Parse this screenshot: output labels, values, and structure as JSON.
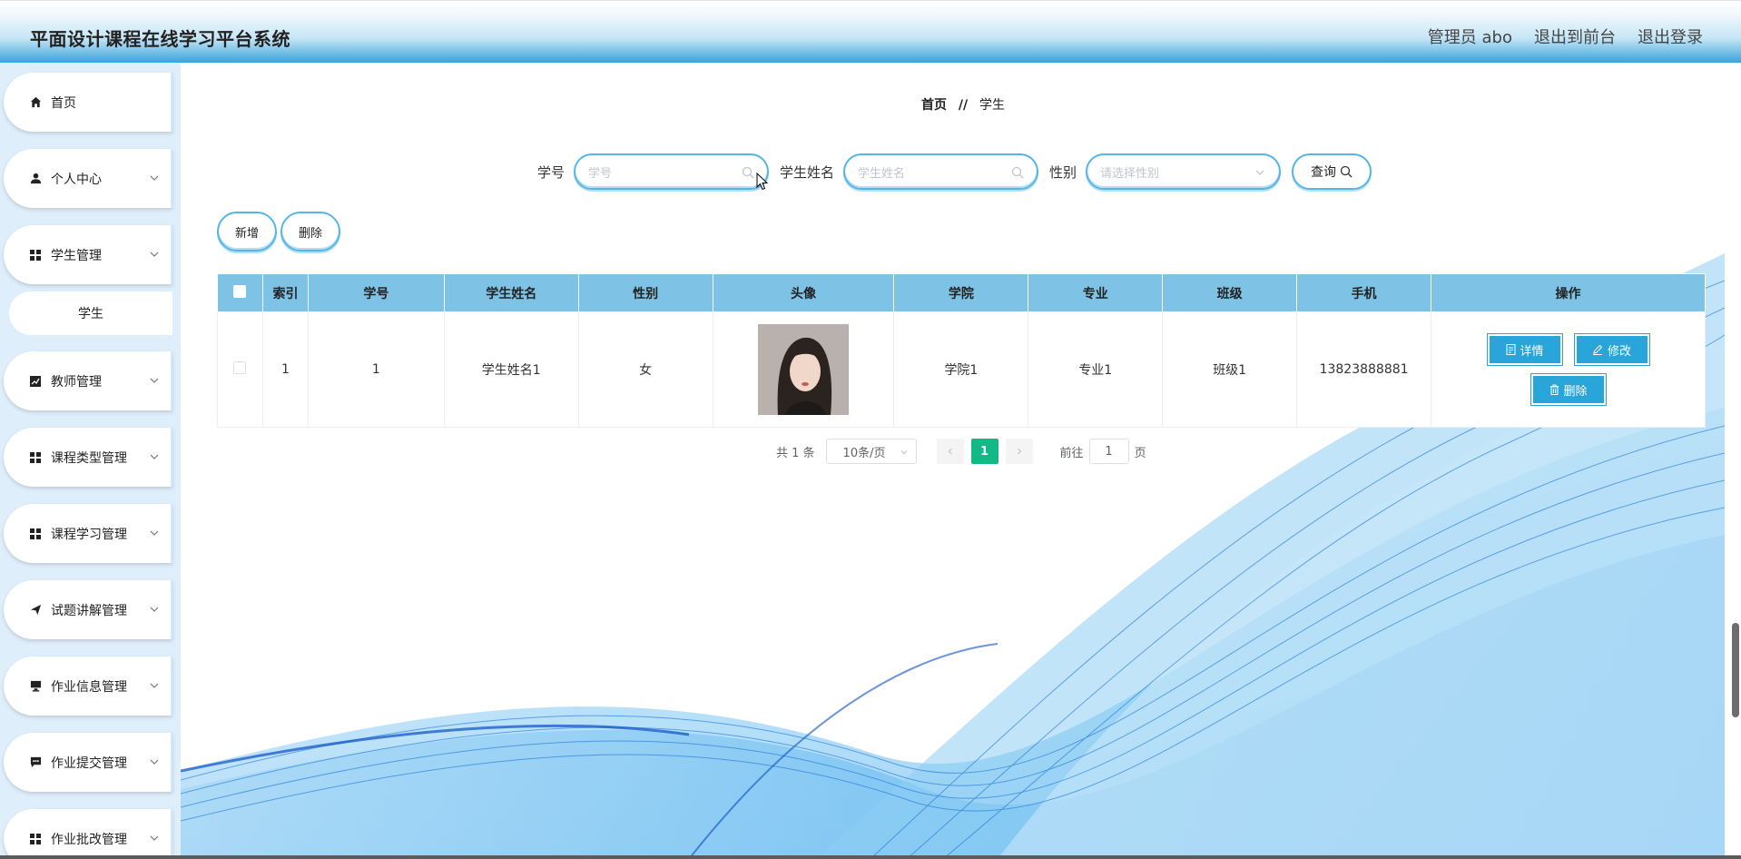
{
  "header": {
    "title": "平面设计课程在线学习平台系统",
    "admin": "管理员 abo",
    "to_front": "退出到前台",
    "logout": "退出登录"
  },
  "sidebar": {
    "items": [
      {
        "label": "首页",
        "icon": "home-icon"
      },
      {
        "label": "个人中心",
        "icon": "user-icon"
      },
      {
        "label": "学生管理",
        "icon": "grid-icon"
      },
      {
        "label": "教师管理",
        "icon": "chart-icon"
      },
      {
        "label": "课程类型管理",
        "icon": "grid-icon"
      },
      {
        "label": "课程学习管理",
        "icon": "grid-icon"
      },
      {
        "label": "试题讲解管理",
        "icon": "send-icon"
      },
      {
        "label": "作业信息管理",
        "icon": "monitor-icon"
      },
      {
        "label": "作业提交管理",
        "icon": "message-icon"
      },
      {
        "label": "作业批改管理",
        "icon": "grid-icon"
      }
    ],
    "sub_item": "学生"
  },
  "breadcrumb": {
    "home": "首页",
    "sep": "//",
    "current": "学生"
  },
  "search": {
    "xuehao_label": "学号",
    "xuehao_placeholder": "学号",
    "name_label": "学生姓名",
    "name_placeholder": "学生姓名",
    "gender_label": "性别",
    "gender_placeholder": "请选择性别",
    "query_label": "查询"
  },
  "actions": {
    "add": "新增",
    "delete": "删除"
  },
  "table": {
    "headers": [
      "索引",
      "学号",
      "学生姓名",
      "性别",
      "头像",
      "学院",
      "专业",
      "班级",
      "手机",
      "操作"
    ],
    "rows": [
      {
        "index": "1",
        "xuehao": "1",
        "name": "学生姓名1",
        "gender": "女",
        "college": "学院1",
        "major": "专业1",
        "class": "班级1",
        "phone": "13823888881",
        "ops": {
          "detail": "详情",
          "edit": "修改",
          "delete": "删除"
        }
      }
    ]
  },
  "pager": {
    "total": "共 1 条",
    "size": "10条/页",
    "current": "1",
    "goto": "前往",
    "goto_value": "1",
    "page_unit": "页"
  },
  "colors": {
    "accent": "#2aa5da",
    "header_th": "#7ec3e6",
    "active_page": "#13b887",
    "sidebar_bg": "#dfeefb"
  }
}
